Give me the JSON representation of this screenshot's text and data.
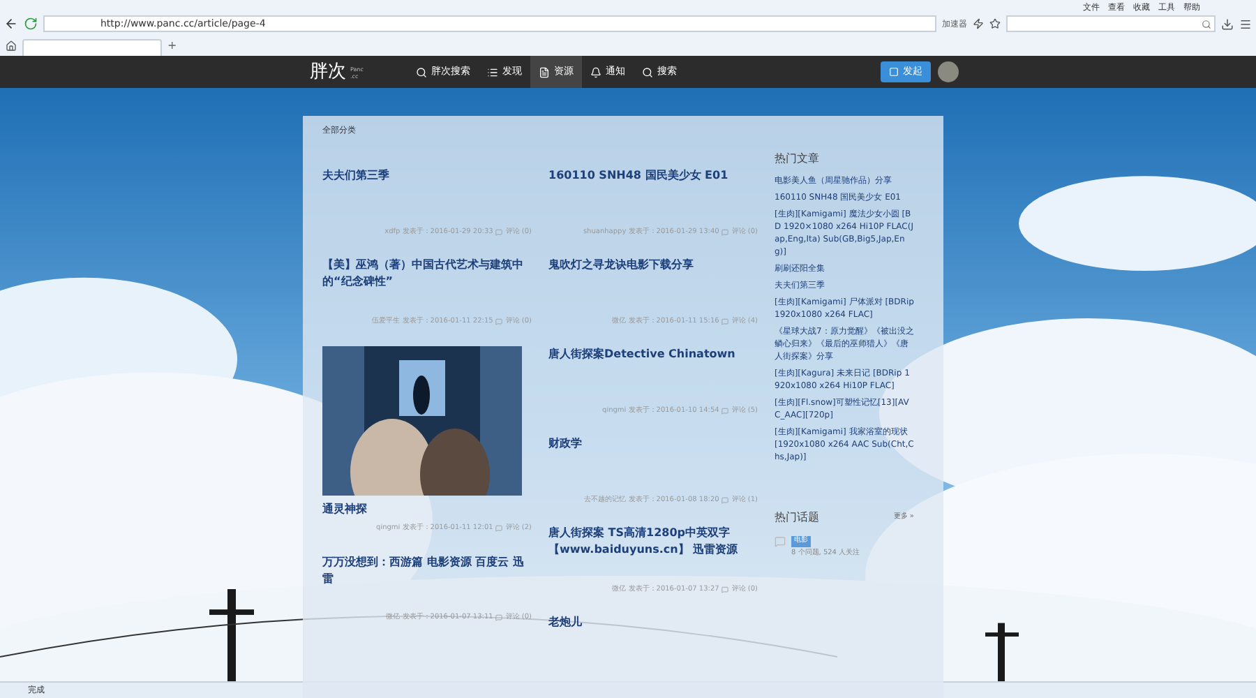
{
  "browser": {
    "menu": [
      "文件",
      "查看",
      "收藏",
      "工具",
      "帮助"
    ],
    "url": "http://www.panc.cc/article/page-4",
    "accelerator": "加速器",
    "new_tab": "+"
  },
  "site_nav": {
    "logo": "胖次",
    "logo_sub": "Panc .cc",
    "items": [
      {
        "label": "胖次搜索",
        "kind": "search",
        "selected": false
      },
      {
        "label": "发现",
        "kind": "list",
        "selected": false
      },
      {
        "label": "资源",
        "kind": "doc",
        "selected": true
      },
      {
        "label": "通知",
        "kind": "bell",
        "selected": false
      },
      {
        "label": "搜索",
        "kind": "search",
        "selected": false
      }
    ],
    "publish_button": "发起"
  },
  "content": {
    "breadcrumb": "全部分类",
    "columns": [
      [
        {
          "kind": "text",
          "title": "夫夫们第三季",
          "meta": "xdfp 发表于：2016-01-29 20:33",
          "comments": "评论 (0)"
        },
        {
          "kind": "text",
          "title": "【美】巫鸿（著）中国古代艺术与建筑中的“纪念碑性”",
          "meta": "伍爱平生 发表于：2016-01-11 22:15",
          "comments": "评论 (0)"
        },
        {
          "kind": "picture",
          "title": "通灵神探",
          "meta": "qingmi 发表于：2016-01-11 12:01",
          "comments": "评论 (2)"
        },
        {
          "kind": "text",
          "title": "万万没想到：西游篇 电影资源 百度云 迅雷",
          "meta": "微亿 发表于：2016-01-07 13:11",
          "comments": "评论 (0)"
        }
      ],
      [
        {
          "kind": "text",
          "title": "160110 SNH48 国民美少女 E01",
          "meta": "shuanhappy 发表于：2016-01-29 13:40",
          "comments": "评论 (0)"
        },
        {
          "kind": "text",
          "title": "鬼吹灯之寻龙诀电影下载分享",
          "meta": "微亿 发表于：2016-01-11 15:16",
          "comments": "评论 (4)"
        },
        {
          "kind": "text",
          "title": "唐人街探案Detective Chinatown",
          "meta": "qingmi 发表于：2016-01-10 14:54",
          "comments": "评论 (5)"
        },
        {
          "kind": "text",
          "title": "财政学",
          "meta": "去不越的记忆 发表于：2016-01-08 18:20",
          "comments": "评论 (1)"
        },
        {
          "kind": "text",
          "title": "唐人街探案 TS高清1280p中英双字【www.baiduyuns.cn】 迅雷资源",
          "meta": "微亿 发表于：2016-01-07 13:27",
          "comments": "评论 (0)"
        },
        {
          "kind": "cut",
          "title": "老炮儿"
        }
      ]
    ],
    "hot_articles": {
      "title": "热门文章",
      "items": [
        "电影美人鱼（周星驰作品）分享",
        "160110 SNH48 国民美少女 E01",
        "[生肉][Kamigami] 魔法少女小圆 [BD 1920×1080 x264 Hi10P FLAC(Jap,Eng,Ita) Sub(GB,Big5,Jap,Eng)]",
        "刷刷还阳全集",
        "夫夫们第三季",
        "[生肉][Kamigami] 尸体派对 [BDRip 1920x1080 x264 FLAC]",
        "《星球大战7：原力觉醒》《被出没之鳞心归来》《最后的巫师猎人》《唐人街探案》分享",
        "[生肉][Kagura] 未来日记 [BDRip 1920x1080 x264 Hi10P FLAC]",
        "[生肉][Fl.snow]可塑性记忆[13][AVC_AAC][720p]",
        "[生肉][Kamigami] 我家浴室的现状 [1920x1080 x264 AAC Sub(Cht,Chs,Jap)]"
      ]
    },
    "hot_topics": {
      "title": "热门话题",
      "more": "更多 »",
      "items": [
        {
          "tag": "电影",
          "stats": "8 个问题, 524 人关注"
        }
      ]
    }
  },
  "status_bar": {
    "text": "完成"
  }
}
